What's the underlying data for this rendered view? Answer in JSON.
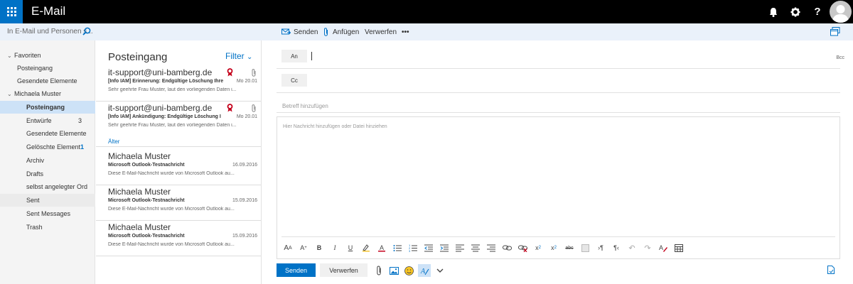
{
  "app": {
    "title": "E-Mail"
  },
  "colors": {
    "accent": "#0072c6",
    "topbar": "#000000",
    "subbar": "#eaf1fa",
    "selected": "#cde2f7",
    "flag": "#c4001b"
  },
  "search": {
    "placeholder": "In E-Mail und Personen s..."
  },
  "toolbar": {
    "send_label": "Senden",
    "attach_label": "Anfügen",
    "discard_label": "Verwerfen",
    "more_label": "•••"
  },
  "nav": {
    "favorites": "Favoriten",
    "fav_items": [
      {
        "label": "Posteingang"
      },
      {
        "label": "Gesendete Elemente"
      }
    ],
    "account": "Michaela Muster",
    "folders": [
      {
        "label": "Posteingang",
        "count": ""
      },
      {
        "label": "Entwürfe",
        "count": "3"
      },
      {
        "label": "Gesendete Elemente",
        "count": ""
      },
      {
        "label": "Gelöschte Element",
        "count": "1"
      },
      {
        "label": "Archiv",
        "count": ""
      },
      {
        "label": "Drafts",
        "count": ""
      },
      {
        "label": "selbst angelegter Ord",
        "count": ""
      },
      {
        "label": "Sent",
        "count": ""
      },
      {
        "label": "Sent Messages",
        "count": ""
      },
      {
        "label": "Trash",
        "count": ""
      }
    ]
  },
  "list": {
    "title": "Posteingang",
    "filter": "Filter",
    "older": "Älter",
    "messages": [
      {
        "sender": "it-support@uni-bamberg.de",
        "subject": "[Info IAM] Erinnerung: Endgültige Löschung Ihre",
        "preview": "Sehr geehrte Frau Muster, laut den vorliegenden Daten i...",
        "date": "Mo 20.01"
      },
      {
        "sender": "it-support@uni-bamberg.de",
        "subject": "[Info IAM] Ankündigung: Endgültige Löschung I",
        "preview": "Sehr geehrte Frau Muster, laut den vorliegenden Daten i...",
        "date": "Mo 20.01"
      },
      {
        "sender": "Michaela Muster",
        "subject": "Microsoft Outlook-Testnachricht",
        "preview": "Diese E-Mail-Nachricht wurde von Microsoft Outlook au...",
        "date": "16.09.2016"
      },
      {
        "sender": "Michaela Muster",
        "subject": "Microsoft Outlook-Testnachricht",
        "preview": "Diese E-Mail-Nachricht wurde von Microsoft Outlook au...",
        "date": "15.09.2016"
      },
      {
        "sender": "Michaela Muster",
        "subject": "Microsoft Outlook-Testnachricht",
        "preview": "Diese E-Mail-Nachricht wurde von Microsoft Outlook au...",
        "date": "15.09.2016"
      }
    ]
  },
  "compose": {
    "to_label": "An",
    "cc_label": "Cc",
    "bcc_label": "Bcc",
    "subject_placeholder": "Betreff hinzufügen",
    "body_placeholder": "Hier Nachricht hinzufügen oder Datei hinziehen",
    "send_label": "Senden",
    "discard_label": "Verwerfen"
  }
}
